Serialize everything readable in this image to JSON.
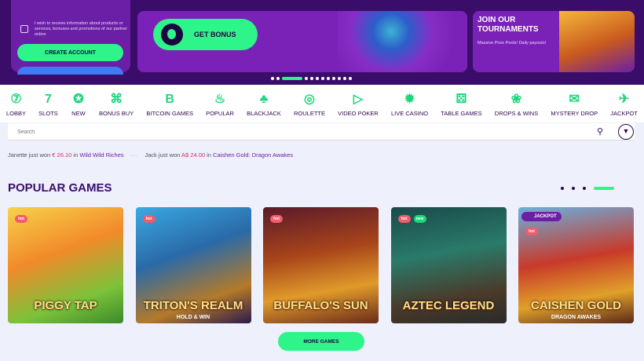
{
  "promo": {
    "opt_in_text": "I wish to receive information about products or services, bonuses and promotions of our partner online",
    "create_account_label": "CREATE ACCOUNT"
  },
  "hero": {
    "get_bonus_label": "GET BONUS"
  },
  "tournament": {
    "title": "JOIN OUR TOURNAMENTS",
    "subtitle": "Massive Prize Pools! Daily payouts!"
  },
  "categories": [
    {
      "label": "LOBBY",
      "icon": "lobby-icon",
      "glyph": "⑦"
    },
    {
      "label": "SLOTS",
      "icon": "slots-icon",
      "glyph": "7"
    },
    {
      "label": "NEW",
      "icon": "new-icon",
      "glyph": "✪"
    },
    {
      "label": "BONUS BUY",
      "icon": "bonus-buy-icon",
      "glyph": "⌘"
    },
    {
      "label": "BITCOIN GAMES",
      "icon": "bitcoin-icon",
      "glyph": "B"
    },
    {
      "label": "POPULAR",
      "icon": "fire-icon",
      "glyph": "♨"
    },
    {
      "label": "BLACKJACK",
      "icon": "club-icon",
      "glyph": "♣"
    },
    {
      "label": "ROULETTE",
      "icon": "roulette-icon",
      "glyph": "◎"
    },
    {
      "label": "VIDEO POKER",
      "icon": "play-icon",
      "glyph": "▷"
    },
    {
      "label": "LIVE CASINO",
      "icon": "live-casino-icon",
      "glyph": "✹"
    },
    {
      "label": "TABLE GAMES",
      "icon": "dice-icon",
      "glyph": "⚄"
    },
    {
      "label": "DROPS & WINS",
      "icon": "drops-wins-icon",
      "glyph": "❀"
    },
    {
      "label": "MYSTERY DROP",
      "icon": "mystery-drop-icon",
      "glyph": "✉"
    },
    {
      "label": "JACKPOT",
      "icon": "jackpot-icon",
      "glyph": "✈"
    }
  ],
  "search": {
    "placeholder": "Search"
  },
  "ticker": [
    {
      "player": "Janette just won",
      "amount": "€ 26.10",
      "prep": "in",
      "game": "Wild Wild Riches"
    },
    {
      "player": "Jack just won",
      "amount": "A$ 24.00",
      "prep": "in",
      "game": "Caishen Gold: Dragon Awakes"
    }
  ],
  "section": {
    "title": "POPULAR GAMES"
  },
  "games": [
    {
      "title": "PIGGY TAP",
      "subtitle": "",
      "badges": [
        "hot"
      ],
      "bg": "linear-gradient(160deg,#f7d24a,#f28a2a 40%,#7cc23a 75%,#3a8a2a)"
    },
    {
      "title": "TRITON'S REALM",
      "subtitle": "HOLD & WIN",
      "badges": [
        "hot"
      ],
      "bg": "linear-gradient(160deg,#3aa9e0,#2a6aa8 40%,#b47a2a 75%,#2a1a4a)"
    },
    {
      "title": "BUFFALO'S SUN",
      "subtitle": "",
      "badges": [
        "hot"
      ],
      "bg": "linear-gradient(170deg,#5a1a2a,#a8451a 40%,#e09a2a 70%,#6a2a1a)"
    },
    {
      "title": "AZTEC LEGEND",
      "subtitle": "",
      "badges": [
        "hot",
        "new"
      ],
      "bg": "linear-gradient(170deg,#1a4a4a,#2a7a6a 40%,#4a3a2a 75%,#2a2a2a)"
    },
    {
      "title": "CAISHEN GOLD",
      "subtitle": "DRAGON AWAKES",
      "badges": [
        "hot"
      ],
      "jackpot": "JACKPOT",
      "bg": "linear-gradient(170deg,#6ab0e0,#c83a2a 45%,#e0a02a 75%,#5a2a1a)"
    }
  ],
  "more_games_label": "MORE GAMES"
}
